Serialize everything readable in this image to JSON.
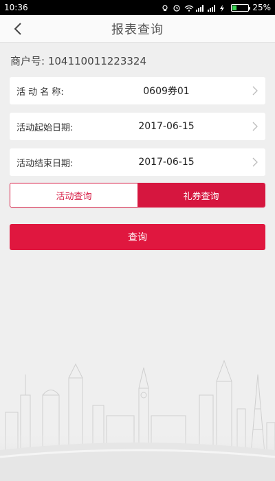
{
  "status_bar": {
    "time": "10:36",
    "battery": "25%"
  },
  "nav": {
    "title": "报表查询"
  },
  "merchant": {
    "label": "商户号:",
    "value": "104110011223324"
  },
  "fields": [
    {
      "label": "活 动 名 称:",
      "value": "0609券01"
    },
    {
      "label": "活动起始日期:",
      "value": "2017-06-15"
    },
    {
      "label": "活动结束日期:",
      "value": "2017-06-15"
    }
  ],
  "tabs": [
    {
      "label": "活动查询",
      "selected": false
    },
    {
      "label": "礼券查询",
      "selected": true
    }
  ],
  "query_button": {
    "label": "查询"
  },
  "colors": {
    "accent": "#e0173f",
    "background": "#efefef"
  },
  "icons": [
    "back-arrow-icon",
    "chevron-right-icon",
    "alarm-icon",
    "wifi-icon",
    "signal-icon",
    "battery-icon"
  ]
}
